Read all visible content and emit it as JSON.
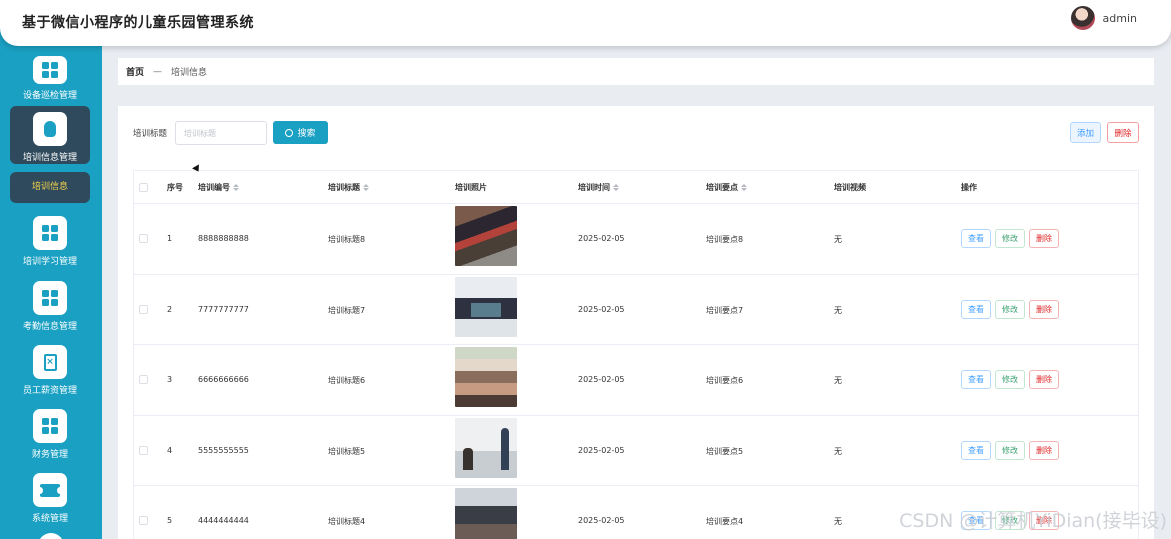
{
  "app": {
    "title": "基于微信小程序的儿童乐园管理系统",
    "username": "admin"
  },
  "sidebar": {
    "items": [
      {
        "label": "设备巡检管理",
        "icon": "grid-icon"
      },
      {
        "label": "培训信息管理",
        "icon": "bulb-icon",
        "active": true
      },
      {
        "label": "培训学习管理",
        "icon": "grid-icon"
      },
      {
        "label": "考勤信息管理",
        "icon": "grid-icon"
      },
      {
        "label": "员工薪资管理",
        "icon": "clipboard-icon"
      },
      {
        "label": "财务管理",
        "icon": "grid-icon"
      },
      {
        "label": "系统管理",
        "icon": "ticket-icon"
      }
    ],
    "sub_item": "培训信息"
  },
  "breadcrumb": {
    "home": "首页",
    "separator": "—",
    "current": "培训信息"
  },
  "search": {
    "label": "培训标题",
    "placeholder": "培训标题",
    "button": "搜索"
  },
  "actions": {
    "add": "添加",
    "delete": "删除"
  },
  "table": {
    "headers": {
      "index": "序号",
      "code": "培训编号",
      "title": "培训标题",
      "photo": "培训照片",
      "time": "培训时间",
      "points": "培训要点",
      "video": "培训视频",
      "ops": "操作"
    },
    "row_actions": {
      "view": "查看",
      "edit": "修改",
      "delete": "删除"
    },
    "rows": [
      {
        "index": "1",
        "code": "8888888888",
        "title": "培训标题8",
        "time": "2025-02-05",
        "points": "培训要点8",
        "video": "无"
      },
      {
        "index": "2",
        "code": "7777777777",
        "title": "培训标题7",
        "time": "2025-02-05",
        "points": "培训要点7",
        "video": "无"
      },
      {
        "index": "3",
        "code": "6666666666",
        "title": "培训标题6",
        "time": "2025-02-05",
        "points": "培训要点6",
        "video": "无"
      },
      {
        "index": "4",
        "code": "5555555555",
        "title": "培训标题5",
        "time": "2025-02-05",
        "points": "培训要点5",
        "video": "无"
      },
      {
        "index": "5",
        "code": "4444444444",
        "title": "培训标题4",
        "time": "2025-02-05",
        "points": "培训要点4",
        "video": "无"
      }
    ]
  },
  "watermark": "CSDN @计算机YiDian(接毕设)",
  "colors": {
    "primary": "#1aa0c2",
    "active_nav": "#2f4a5c",
    "active_sub_text": "#f7d44a",
    "danger": "#e02424"
  }
}
